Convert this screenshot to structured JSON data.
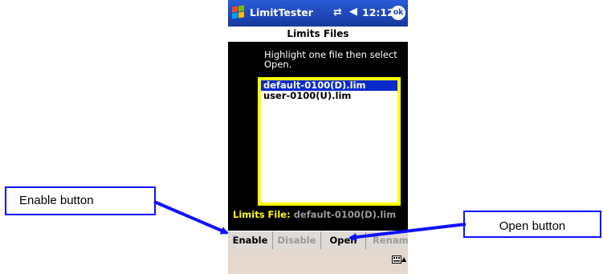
{
  "titlebar": {
    "app_name": "LimitTester",
    "time": "12:12",
    "ok_label": "ok"
  },
  "header": {
    "title": "Limits Files"
  },
  "instruction": "Highlight one file then select Open.",
  "files": [
    "default-0100(D).lim",
    "user-0100(U).lim"
  ],
  "selected_index": 0,
  "limits_file": {
    "label": "Limits File:",
    "value": "default-0100(D).lim"
  },
  "buttons": [
    {
      "label": "Enable",
      "enabled": true
    },
    {
      "label": "Disable",
      "enabled": false
    },
    {
      "label": "Open",
      "enabled": true
    },
    {
      "label": "Rename",
      "enabled": false
    }
  ],
  "callouts": {
    "enable": "Enable button",
    "open": "Open button"
  },
  "colors": {
    "titlebar": "#1f47b8",
    "selection": "#0a2acb",
    "box_border": "#ffff00",
    "callout_border": "#1010ff"
  }
}
